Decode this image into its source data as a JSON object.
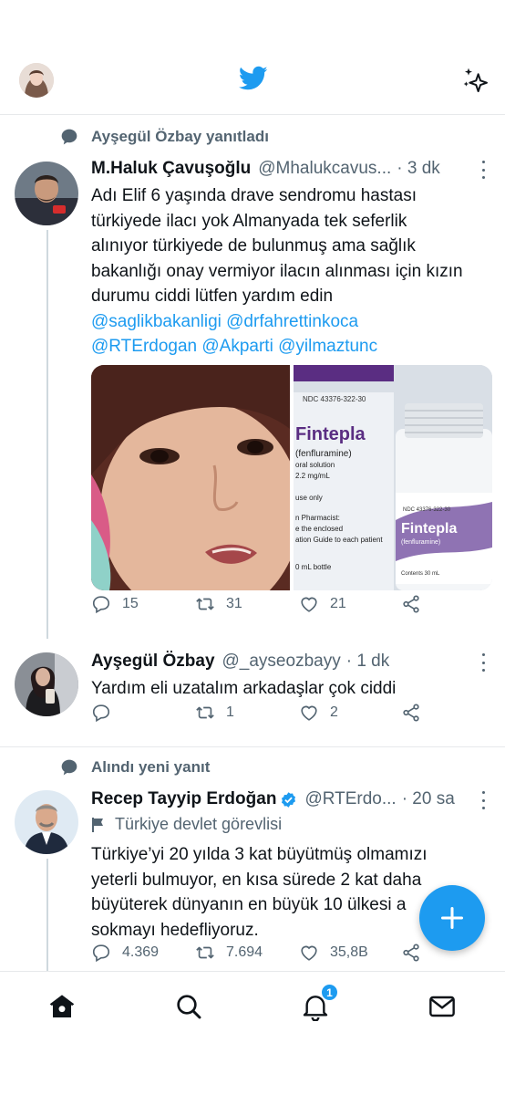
{
  "colors": {
    "accent": "#1d9bf0",
    "secondary_text": "#536471",
    "primary_text": "#0f1419",
    "divider": "#e7e9eb"
  },
  "header": {
    "logo": "twitter-bird-icon",
    "sparkle": "sparkle-icon"
  },
  "feed": [
    {
      "context": "Ayşegül Özbay yanıtladı",
      "name": "M.Haluk Çavuşoğlu",
      "handle": "@Mhalukcavus...",
      "time": "· 3 dk",
      "text_lines": [
        "Adı Elif  6 yaşında  drave sendromu hastası",
        "türkiyede ilacı yok Almanyada tek seferlik",
        "alınıyor   türkiyede de bulunmuş ama sağlık",
        "bakanlığı onay vermiyor ilacın alınması için kızın",
        "durumu ciddi lütfen yardım edin"
      ],
      "mentions_line1": "@saglikbakanligi @drfahrettinkoca",
      "mentions_line2": "@RTErdogan @Akparti @yilmaztunc",
      "media": {
        "medicine_label_ndc": "NDC 43376-322-30",
        "brand": "Fintepla",
        "generic": "(fenfluramine)",
        "form": "oral solution",
        "strength": "2.2 mg/mL",
        "use": "use only",
        "pharmacist": "n Pharmacist:",
        "enclosed": "e the enclosed",
        "guide": "ation Guide to each patient",
        "bottle": "0 mL bottle",
        "bottle_ndc": "NDC 43376-322-30",
        "bottle_contents": "Contents 30 mL"
      },
      "replies": "15",
      "retweets": "31",
      "likes": "21"
    },
    {
      "name": "Ayşegül Özbay",
      "handle": "@_ayseozbayy",
      "time": "· 1 dk",
      "text": "Yardım eli uzatalım arkadaşlar çok ciddi",
      "replies": "",
      "retweets": "1",
      "likes": "2"
    },
    {
      "context": "Alındı yeni yanıt",
      "name": "Recep Tayyip Erdoğan",
      "handle": "@RTErdo...",
      "time": "· 20 sa",
      "label": "Türkiye devlet görevlisi",
      "text_lines": [
        "Türkiye’yi 20 yılda 3 kat büyütmüş olmamızı",
        "yeterli bulmuyor, en kısa sürede 2 kat daha",
        "büyüterek dünyanın en büyük 10 ülkesi a",
        "sokmayı hedefliyoruz."
      ],
      "replies": "4.369",
      "retweets": "7.694",
      "likes": "35,8B"
    }
  ],
  "bottom_nav": {
    "items": [
      "home-icon",
      "search-icon",
      "notifications-icon",
      "messages-icon"
    ],
    "notification_count": "1"
  },
  "fab": "compose-plus-icon"
}
